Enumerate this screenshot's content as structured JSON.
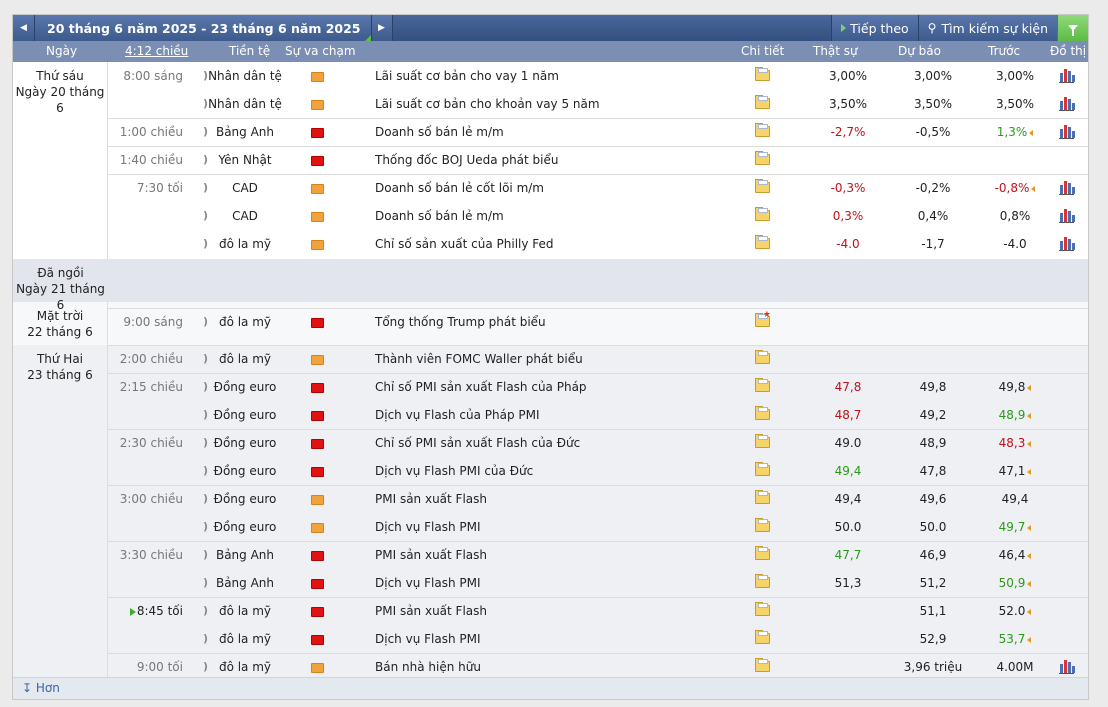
{
  "toolbar": {
    "date_range": "20 tháng 6 năm 2025 - 23 tháng 6 năm 2025",
    "next_label": "Tiếp theo",
    "search_label": "Tìm kiếm sự kiện"
  },
  "columns": {
    "day": "Ngày",
    "time": "4:12 chiều",
    "currency": "Tiền tệ",
    "impact": "Sự va chạm",
    "detail": "Chi tiết",
    "actual": "Thật sự",
    "forecast": "Dự báo",
    "previous": "Trước",
    "graph": "Đồ thị"
  },
  "days": [
    {
      "line1": "Thứ sáu",
      "line2": "Ngày 20 tháng 6"
    },
    {
      "line1": "Đã ngồi",
      "line2": "Ngày 21 tháng 6"
    },
    {
      "line1": "Mặt trời",
      "line2": "22 tháng 6"
    },
    {
      "line1": "Thứ Hai",
      "line2": "23 tháng 6"
    }
  ],
  "events": [
    {
      "time": "8:00 sáng",
      "currency": "Nhân dân tệ",
      "impact": "medium",
      "name": "Lãi suất cơ bản cho vay 1 năm",
      "actual": "3,00%",
      "forecast": "3,00%",
      "previous": "3,00%"
    },
    {
      "time": "",
      "currency": "Nhân dân tệ",
      "impact": "medium",
      "name": "Lãi suất cơ bản cho khoản vay 5 năm",
      "actual": "3,50%",
      "forecast": "3,50%",
      "previous": "3,50%"
    },
    {
      "time": "1:00 chiều",
      "currency": "Bảng Anh",
      "impact": "high",
      "name": "Doanh số bán lẻ m/m",
      "actual": "-2,7%",
      "forecast": "-0,5%",
      "previous": "1,3%"
    },
    {
      "time": "1:40 chiều",
      "currency": "Yên Nhật",
      "impact": "high",
      "name": "Thống đốc BOJ Ueda phát biểu",
      "actual": "",
      "forecast": "",
      "previous": ""
    },
    {
      "time": "7:30 tối",
      "currency": "CAD",
      "impact": "medium",
      "name": "Doanh số bán lẻ cốt lõi m/m",
      "actual": "-0,3%",
      "forecast": "-0,2%",
      "previous": "-0,8%"
    },
    {
      "time": "",
      "currency": "CAD",
      "impact": "medium",
      "name": "Doanh số bán lẻ m/m",
      "actual": "0,3%",
      "forecast": "0,4%",
      "previous": "0,8%"
    },
    {
      "time": "",
      "currency": "đô la mỹ",
      "impact": "medium",
      "name": "Chỉ số sản xuất của Philly Fed",
      "actual": "-4.0",
      "forecast": "-1,7",
      "previous": "-4.0"
    },
    {
      "time": "9:00 sáng",
      "currency": "đô la mỹ",
      "impact": "high",
      "name": "Tổng thống Trump phát biểu",
      "actual": "",
      "forecast": "",
      "previous": ""
    },
    {
      "time": "2:00 chiều",
      "currency": "đô la mỹ",
      "impact": "medium",
      "name": "Thành viên FOMC Waller phát biểu",
      "actual": "",
      "forecast": "",
      "previous": ""
    },
    {
      "time": "2:15 chiều",
      "currency": "Đồng euro",
      "impact": "high",
      "name": "Chỉ số PMI sản xuất Flash của Pháp",
      "actual": "47,8",
      "forecast": "49,8",
      "previous": "49,8"
    },
    {
      "time": "",
      "currency": "Đồng euro",
      "impact": "high",
      "name": "Dịch vụ Flash của Pháp PMI",
      "actual": "48,7",
      "forecast": "49,2",
      "previous": "48,9"
    },
    {
      "time": "2:30 chiều",
      "currency": "Đồng euro",
      "impact": "high",
      "name": "Chỉ số PMI sản xuất Flash của Đức",
      "actual": "49.0",
      "forecast": "48,9",
      "previous": "48,3"
    },
    {
      "time": "",
      "currency": "Đồng euro",
      "impact": "high",
      "name": "Dịch vụ Flash PMI của Đức",
      "actual": "49,4",
      "forecast": "47,8",
      "previous": "47,1"
    },
    {
      "time": "3:00 chiều",
      "currency": "Đồng euro",
      "impact": "medium",
      "name": "PMI sản xuất Flash",
      "actual": "49,4",
      "forecast": "49,6",
      "previous": "49,4"
    },
    {
      "time": "",
      "currency": "Đồng euro",
      "impact": "medium",
      "name": "Dịch vụ Flash PMI",
      "actual": "50.0",
      "forecast": "50.0",
      "previous": "49,7"
    },
    {
      "time": "3:30 chiều",
      "currency": "Bảng Anh",
      "impact": "high",
      "name": "PMI sản xuất Flash",
      "actual": "47,7",
      "forecast": "46,9",
      "previous": "46,4"
    },
    {
      "time": "",
      "currency": "Bảng Anh",
      "impact": "high",
      "name": "Dịch vụ Flash PMI",
      "actual": "51,3",
      "forecast": "51,2",
      "previous": "50,9"
    },
    {
      "time": "8:45 tối",
      "currency": "đô la mỹ",
      "impact": "high",
      "name": "PMI sản xuất Flash",
      "actual": "",
      "forecast": "51,1",
      "previous": "52.0"
    },
    {
      "time": "",
      "currency": "đô la mỹ",
      "impact": "high",
      "name": "Dịch vụ Flash PMI",
      "actual": "",
      "forecast": "52,9",
      "previous": "53,7"
    },
    {
      "time": "9:00 tối",
      "currency": "đô la mỹ",
      "impact": "medium",
      "name": "Bán nhà hiện hữu",
      "actual": "",
      "forecast": "3,96 triệu",
      "previous": "4.00M"
    }
  ],
  "footer": {
    "more_label": "Hơn"
  },
  "colors": {
    "header": "#34507f",
    "colhead": "#7a8fb3",
    "actual_worse": "#c0121a",
    "actual_better": "#2a9a1a",
    "impact_high": "#e01212",
    "impact_medium": "#f2a23a"
  }
}
